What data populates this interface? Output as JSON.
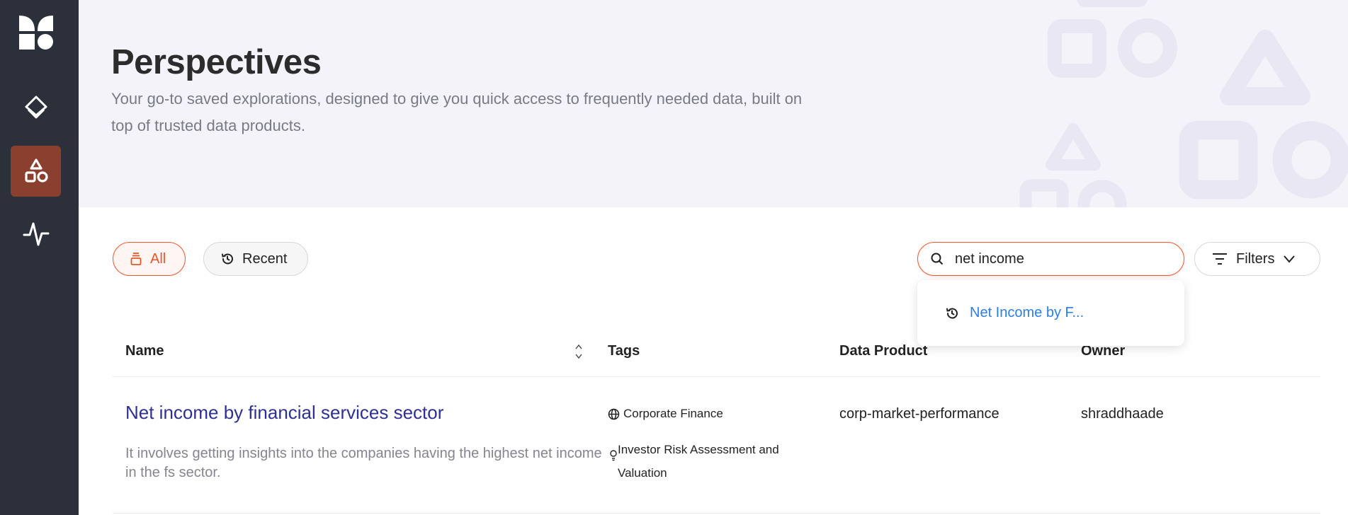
{
  "sidebar": {
    "items": [
      {
        "icon": "layers-icon"
      },
      {
        "icon": "shapes-icon",
        "active": true
      },
      {
        "icon": "activity-icon"
      }
    ],
    "active_color": "#8b3f2f"
  },
  "header": {
    "title": "Perspectives",
    "subtitle": "Your go-to saved explorations, designed to give you quick access to frequently needed data, built on top of trusted data products."
  },
  "toolbar": {
    "all_label": "All",
    "recent_label": "Recent",
    "filters_label": "Filters"
  },
  "search": {
    "value": "net income",
    "suggestion": "Net Income by F..."
  },
  "table": {
    "columns": [
      "Name",
      "Tags",
      "Data Product",
      "Owner"
    ],
    "rows": [
      {
        "name": "Net income by financial services sector",
        "description": "It involves getting insights into the companies having the highest net income in the fs sector.",
        "tags": [
          {
            "icon": "globe-icon",
            "label": "Corporate Finance"
          },
          {
            "icon": "lightbulb-icon",
            "label": "Investor Risk Assessment and Valuation"
          }
        ],
        "data_product": "corp-market-performance",
        "owner": "shraddhaade"
      }
    ]
  },
  "colors": {
    "accent": "#f0562a",
    "link": "#2e3192",
    "suggestion": "#2a7fe8"
  }
}
